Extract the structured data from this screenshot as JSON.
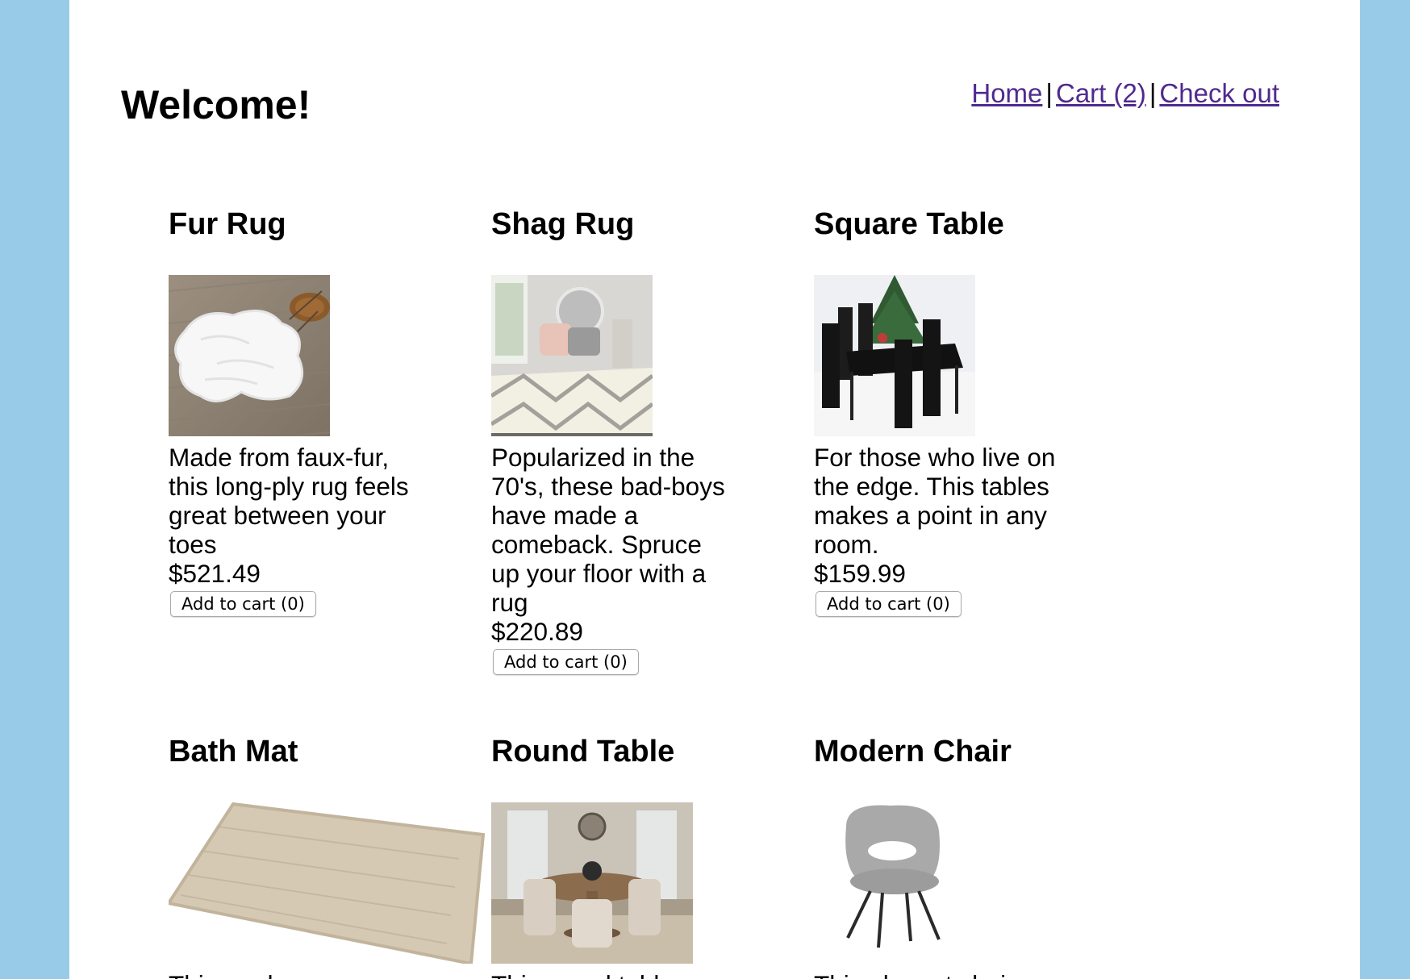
{
  "header": {
    "title": "Welcome!",
    "nav": {
      "home": "Home",
      "sep1": "|",
      "cart": "Cart (2)",
      "sep2": "|",
      "checkout": "Check out"
    }
  },
  "products": [
    {
      "name": "Fur Rug",
      "description": "Made from faux-fur, this long-ply rug feels great between your toes",
      "price": "$521.49",
      "button": "Add to cart (0)"
    },
    {
      "name": "Shag Rug",
      "description": "Popularized in the 70's, these bad-boys have made a comeback. Spruce up your floor with a rug",
      "price": "$220.89",
      "button": "Add to cart (0)"
    },
    {
      "name": "Square Table",
      "description": "For those who live on the edge. This tables makes a point in any room.",
      "price": "$159.99",
      "button": "Add to cart (0)"
    },
    {
      "name": "Bath Mat",
      "description": "This rug has",
      "price": "",
      "button": ""
    },
    {
      "name": "Round Table",
      "description": "This round table",
      "price": "",
      "button": ""
    },
    {
      "name": "Modern Chair",
      "description": "This elegant chair",
      "price": "",
      "button": ""
    }
  ],
  "colors": {
    "side_background": "#98cbe8",
    "page_background": "#ffffff",
    "link": "#4f2a8f"
  }
}
